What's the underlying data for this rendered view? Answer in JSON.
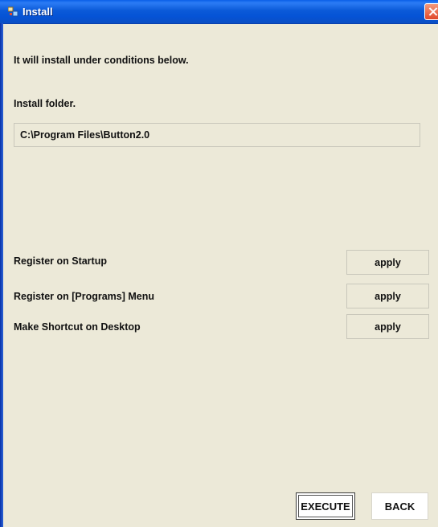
{
  "window": {
    "title": "Install",
    "icon": "installer-icon"
  },
  "intro": "It will install under conditions below.",
  "install_folder": {
    "label": "Install folder.",
    "path": "C:\\Program Files\\Button2.0"
  },
  "options": [
    {
      "label": "Register on Startup",
      "button": "apply"
    },
    {
      "label": "Register on [Programs] Menu",
      "button": "apply"
    },
    {
      "label": "Make Shortcut on Desktop",
      "button": "apply"
    }
  ],
  "buttons": {
    "execute": "EXECUTE",
    "back": "BACK"
  },
  "colors": {
    "titlebar": "#0553d6",
    "window_bg": "#ece9d8",
    "close": "#e0482a"
  }
}
